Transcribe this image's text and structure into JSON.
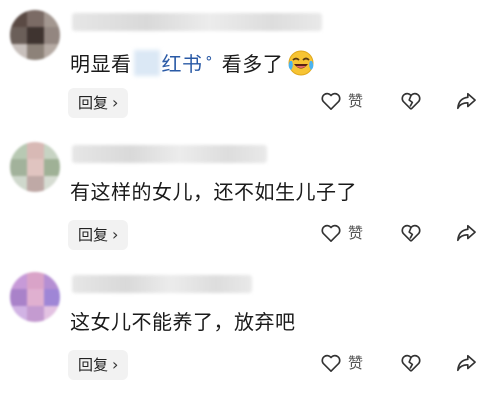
{
  "comments": [
    {
      "text_prefix": "明显看",
      "link_text": "红书",
      "text_suffix": "看多了",
      "reply_label": "回复",
      "like_label": "赞",
      "avatar_colors": [
        "#5a4a44",
        "#7b6b65",
        "#a39790",
        "#6b5f59",
        "#3f3430",
        "#938680",
        "#c8c0bc",
        "#8d8279",
        "#b5aaa3"
      ]
    },
    {
      "text": "有这样的女儿，还不如生儿子了",
      "reply_label": "回复",
      "like_label": "赞",
      "avatar_colors": [
        "#b8c9b3",
        "#d8b9b5",
        "#c7d3c3",
        "#a2b29b",
        "#e0c4c0",
        "#9fb196",
        "#cfd8cc",
        "#bfa9a6",
        "#d6dcd2"
      ]
    },
    {
      "text": "这女儿不能养了，放弃吧",
      "reply_label": "回复",
      "like_label": "赞",
      "avatar_colors": [
        "#c79ad8",
        "#d9a3c8",
        "#b58fd3",
        "#a982c9",
        "#e0b0d0",
        "#9f86d6",
        "#d1b3e4",
        "#c49bd0",
        "#e3c2e2"
      ]
    }
  ]
}
